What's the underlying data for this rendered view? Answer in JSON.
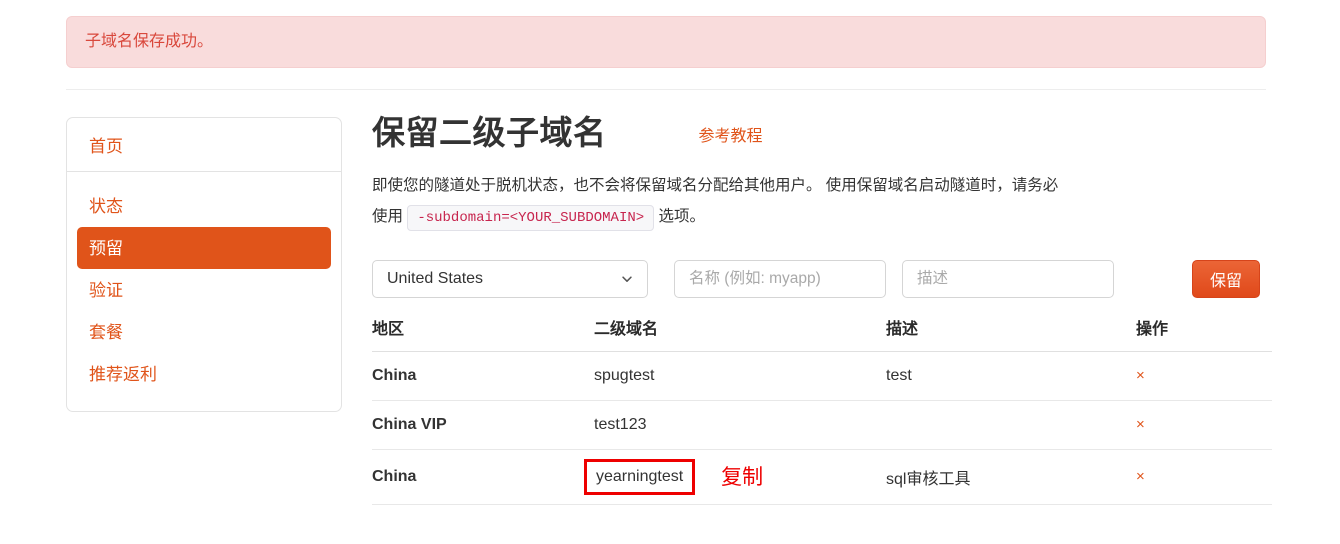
{
  "alert": {
    "message": "子域名保存成功。",
    "bg_color": "#f9dcdc",
    "text_color": "#d9483c"
  },
  "sidebar": {
    "header_label": "首页",
    "items": [
      {
        "label": "状态",
        "active": false
      },
      {
        "label": "预留",
        "active": true
      },
      {
        "label": "验证",
        "active": false
      },
      {
        "label": "套餐",
        "active": false
      },
      {
        "label": "推荐返利",
        "active": false
      }
    ],
    "accent_color": "#e0541a"
  },
  "main": {
    "title": "保留二级子域名",
    "tutorial_link": "参考教程",
    "description_part1": "即使您的隧道处于脱机状态，也不会将保留域名分配给其他用户。 使用保留域名启动隧道时，请务必使用",
    "description_code": "-subdomain=<YOUR_SUBDOMAIN>",
    "description_part2": "选项。"
  },
  "form": {
    "region_selected": "United States",
    "region_chevron_icon": "chevron-down-icon",
    "name_placeholder": "名称 (例如: myapp)",
    "name_value": "",
    "desc_placeholder": "描述",
    "desc_value": "",
    "submit_label": "保留",
    "submit_color": "#e0541a"
  },
  "table": {
    "headers": [
      "地区",
      "二级域名",
      "描述",
      "操作"
    ],
    "delete_icon": "×",
    "rows": [
      {
        "region": "China",
        "domain": "spugtest",
        "description": "test",
        "highlighted": false
      },
      {
        "region": "China VIP",
        "domain": "test123",
        "description": "",
        "highlighted": false
      },
      {
        "region": "China",
        "domain": "yearningtest",
        "description": "sql审核工具",
        "highlighted": true
      }
    ]
  },
  "annotations": {
    "copy_label": "复制",
    "highlight_color": "#ee0000"
  }
}
